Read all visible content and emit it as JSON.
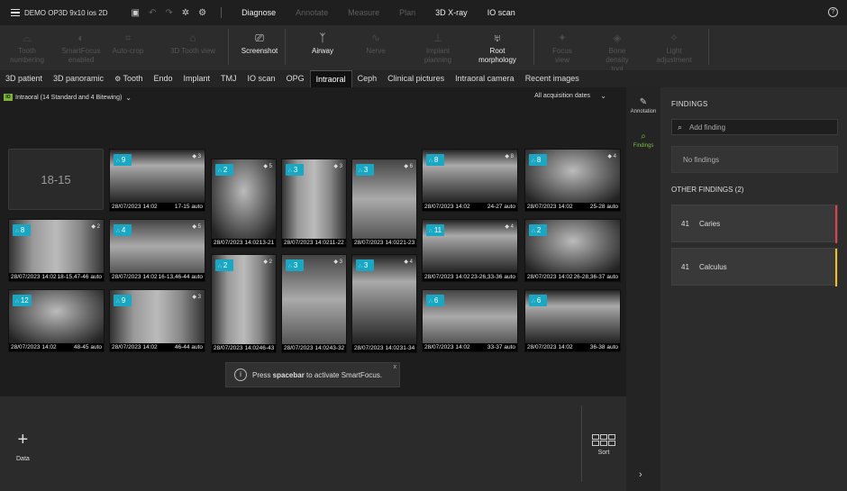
{
  "app": {
    "title": "DEMO OP3D 9x10 ios 2D"
  },
  "topbar": {
    "modes": [
      {
        "label": "Diagnose",
        "active": true
      },
      {
        "label": "Annotate",
        "active": false
      },
      {
        "label": "Measure",
        "active": false
      },
      {
        "label": "Plan",
        "active": false
      },
      {
        "label": "3D X-ray",
        "active": true
      },
      {
        "label": "IO scan",
        "active": true
      }
    ],
    "help": "?"
  },
  "toolbar": {
    "tools": [
      {
        "label": "Tooth\nnumbering",
        "enabled": false,
        "icon": "tooth-numbering-icon"
      },
      {
        "label": "SmartFocus\nenabled",
        "enabled": false,
        "icon": "smartfocus-icon"
      },
      {
        "label": "Auto-crop",
        "enabled": false,
        "icon": "crop-icon"
      },
      {
        "label": "3D Tooth view",
        "enabled": false,
        "icon": "tooth-3d-icon"
      },
      {
        "label": "Screenshot",
        "enabled": true,
        "icon": "screenshot-icon"
      },
      {
        "label": "Airway",
        "enabled": true,
        "icon": "airway-icon"
      },
      {
        "label": "Nerve",
        "enabled": false,
        "icon": "nerve-icon"
      },
      {
        "label": "Implant\nplanning",
        "enabled": false,
        "icon": "implant-icon"
      },
      {
        "label": "Root\nmorphology",
        "enabled": true,
        "icon": "root-icon"
      },
      {
        "label": "Focus\nview",
        "enabled": false,
        "icon": "focus-icon"
      },
      {
        "label": "Bone\ndensity\ntool",
        "enabled": false,
        "icon": "bone-icon"
      },
      {
        "label": "Light\nadjustment",
        "enabled": false,
        "icon": "light-icon"
      }
    ]
  },
  "tabs": [
    {
      "label": "3D patient"
    },
    {
      "label": "3D panoramic"
    },
    {
      "label": "Tooth",
      "icon": "gear-icon"
    },
    {
      "label": "Endo"
    },
    {
      "label": "Implant"
    },
    {
      "label": "TMJ"
    },
    {
      "label": "IO scan"
    },
    {
      "label": "OPG"
    },
    {
      "label": "Intraoral",
      "active": true
    },
    {
      "label": "Ceph"
    },
    {
      "label": "Clinical pictures"
    },
    {
      "label": "Intraoral camera"
    },
    {
      "label": "Recent images"
    }
  ],
  "subbar": {
    "badge": "IO",
    "title": "Intraoral (14 Standard and 4 Bitewing)",
    "dates": "All acquisition dates"
  },
  "empty_slot": "18-15",
  "thumbs": [
    {
      "badge": "9",
      "stack": "3",
      "date": "28/07/2023 14:02",
      "label": "17-15 auto"
    },
    {
      "badge": "2",
      "stack": "5",
      "date": "28/07/2023 14:02",
      "label": "13-21 auto"
    },
    {
      "badge": "3",
      "stack": "3",
      "date": "28/07/2023 14:02",
      "label": "11-22 auto"
    },
    {
      "badge": "3",
      "stack": "6",
      "date": "28/07/2023 14:02",
      "label": "21-23 auto"
    },
    {
      "badge": "8",
      "stack": "8",
      "date": "28/07/2023 14:02",
      "label": "24-27 auto"
    },
    {
      "badge": "8",
      "stack": "4",
      "date": "28/07/2023 14:02",
      "label": "25-28 auto"
    },
    {
      "badge": "8",
      "stack": "2",
      "date": "28/07/2023 14:02",
      "label": "18-15,47-46 auto"
    },
    {
      "badge": "4",
      "stack": "5",
      "date": "28/07/2023 14:02",
      "label": "16-13,46-44 auto"
    },
    {
      "badge": "11",
      "stack": "4",
      "date": "28/07/2023 14:02",
      "label": "23-26,33-36 auto"
    },
    {
      "badge": "2",
      "stack": "",
      "date": "28/07/2023 14:02",
      "label": "26-28,36-37 auto"
    },
    {
      "badge": "2",
      "stack": "2",
      "date": "28/07/2023 14:02",
      "label": "46-43 auto"
    },
    {
      "badge": "3",
      "stack": "3",
      "date": "28/07/2023 14:02",
      "label": "43-32 auto"
    },
    {
      "badge": "3",
      "stack": "4",
      "date": "28/07/2023 14:02",
      "label": "31-34 auto"
    },
    {
      "badge": "12",
      "stack": "",
      "date": "28/07/2023 14:02",
      "label": "48-45 auto"
    },
    {
      "badge": "9",
      "stack": "3",
      "date": "28/07/2023 14:02",
      "label": "46-44 auto"
    },
    {
      "badge": "6",
      "stack": "",
      "date": "28/07/2023 14:02",
      "label": "33-37 auto"
    },
    {
      "badge": "6",
      "stack": "",
      "date": "28/07/2023 14:02",
      "label": "36-38 auto"
    }
  ],
  "toast": {
    "pre": "Press ",
    "key": "spacebar",
    "post": " to activate SmartFocus.",
    "close": "x"
  },
  "bottom": {
    "data_label": "Data",
    "sort_label": "Sort"
  },
  "rail": {
    "annotation": "Annotation",
    "findings": "Findings"
  },
  "panel": {
    "findings_title": "FINDINGS",
    "search_placeholder": "Add finding",
    "no_findings": "No findings",
    "other_title": "OTHER FINDINGS (2)",
    "other": [
      {
        "tooth": "41",
        "name": "Caries",
        "color": "#e0404f"
      },
      {
        "tooth": "41",
        "name": "Calculus",
        "color": "#f0c020"
      }
    ]
  },
  "colors": {
    "accent": "#1aa7c4",
    "active_green": "#7bbd3d"
  }
}
